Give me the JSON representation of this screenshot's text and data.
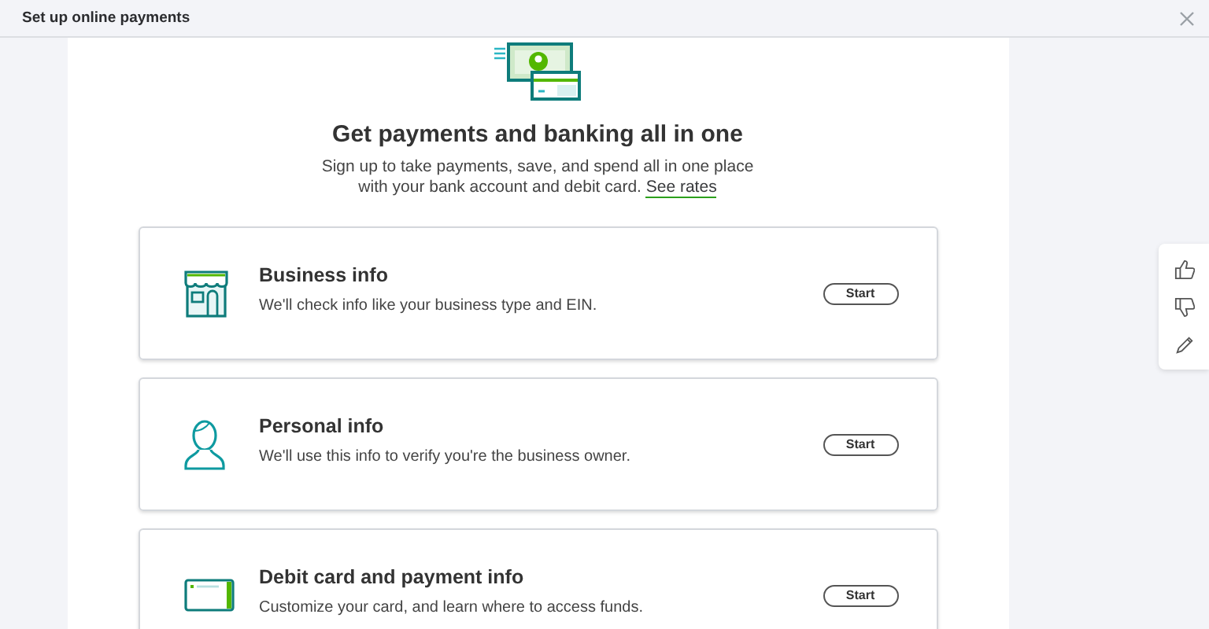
{
  "window": {
    "title": "Set up online payments"
  },
  "heading": "Get payments and banking all in one",
  "intro": {
    "text": "Sign up to take payments, save, and spend all in one place with your bank account and debit card.",
    "link": "See rates"
  },
  "steps": [
    {
      "kind": "store",
      "title": "Business info",
      "description": "We'll check info like your business type and EIN.",
      "button": "Start"
    },
    {
      "kind": "person",
      "title": "Personal info",
      "description": "We'll use this info to verify you're the business owner.",
      "button": "Start"
    },
    {
      "kind": "card",
      "title": "Debit card and payment info",
      "description": "Customize your card, and learn where to access funds.",
      "button": "Start"
    }
  ]
}
